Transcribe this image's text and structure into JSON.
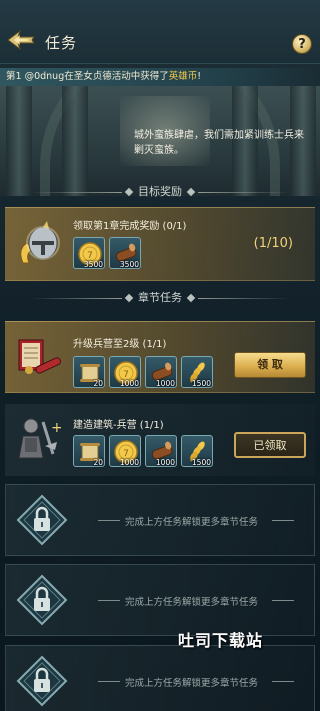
{
  "header": {
    "title": "任务",
    "help_label": "?",
    "back_icon": "back-arrow-icon",
    "help_icon": "help-icon"
  },
  "ticker": {
    "prefix": "第1 ",
    "player": "@0dnug",
    "middle": "在圣女贞德活动中获得了",
    "item": "英雄币",
    "suffix": "!"
  },
  "dialog": {
    "text": "城外蛮族肆虐，我们需加紧训练士兵来剿灭蛮族。"
  },
  "sections": {
    "target_reward": "目标奖励",
    "chapter_tasks": "章节任务"
  },
  "target_reward": {
    "label": "领取第1章完成奖励 (0/1)",
    "progress": "(1/10)",
    "rewards": [
      {
        "icon": "gold-coin-icon",
        "qty": "3500"
      },
      {
        "icon": "wood-log-icon",
        "qty": "3500"
      }
    ]
  },
  "tasks": [
    {
      "label": "升级兵营至2级 (1/1)",
      "icon": "barracks-scroll-icon",
      "button": "领 取",
      "rewards": [
        {
          "icon": "scroll-icon",
          "qty": "20"
        },
        {
          "icon": "gold-coin-icon",
          "qty": "1000"
        },
        {
          "icon": "wood-log-icon",
          "qty": "1000"
        },
        {
          "icon": "wheat-icon",
          "qty": "1500"
        }
      ]
    },
    {
      "label": "建造建筑-兵营 (1/1)",
      "icon": "soldier-icon",
      "button": "已领取",
      "rewards": [
        {
          "icon": "scroll-icon",
          "qty": "20"
        },
        {
          "icon": "gold-coin-icon",
          "qty": "1000"
        },
        {
          "icon": "wood-log-icon",
          "qty": "1000"
        },
        {
          "icon": "wheat-icon",
          "qty": "1500"
        }
      ]
    }
  ],
  "locked": [
    {
      "message": "完成上方任务解锁更多章节任务"
    },
    {
      "message": "完成上方任务解锁更多章节任务"
    },
    {
      "message": "完成上方任务解锁更多章节任务"
    }
  ],
  "watermark": "吐司下载站",
  "colors": {
    "gold_panel": "#8f7540",
    "accent_gold": "#f1d27a",
    "claim_button": "#d9ab4c",
    "background": "#0e1a22"
  }
}
